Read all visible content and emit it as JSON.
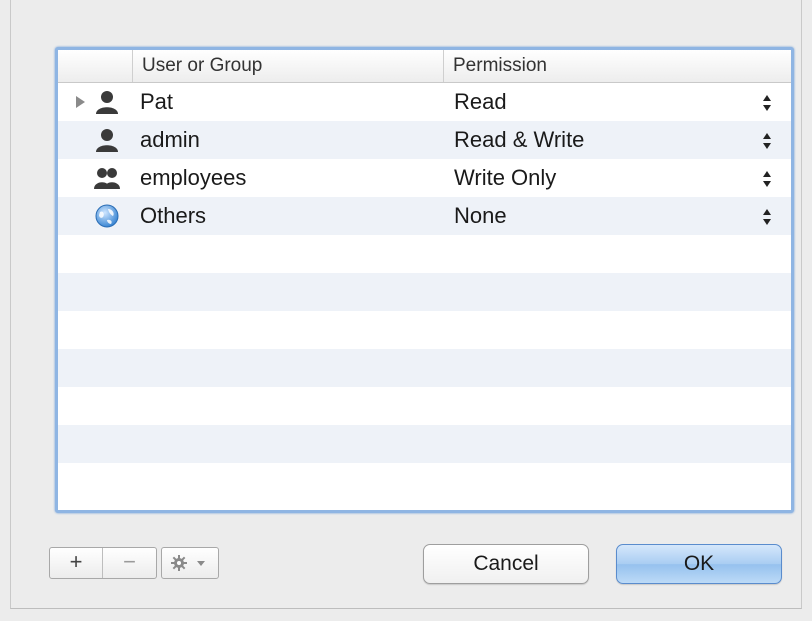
{
  "table": {
    "columns": [
      "User or Group",
      "Permission"
    ],
    "rows": [
      {
        "name": "Pat",
        "icon": "person-icon",
        "permission": "Read",
        "expandable": true
      },
      {
        "name": "admin",
        "icon": "person-icon",
        "permission": "Read & Write",
        "expandable": false
      },
      {
        "name": "employees",
        "icon": "group-icon",
        "permission": "Write Only",
        "expandable": false
      },
      {
        "name": "Others",
        "icon": "globe-icon",
        "permission": "None",
        "expandable": false
      }
    ]
  },
  "toolbar": {
    "add_label": "+",
    "remove_label": "−",
    "actions_icon": "gear-icon"
  },
  "buttons": {
    "cancel_label": "Cancel",
    "ok_label": "OK"
  },
  "colors": {
    "focus_ring": "#8fb5e3",
    "row_stripe": "#eef2f8",
    "default_button": "#a9cdf2"
  }
}
